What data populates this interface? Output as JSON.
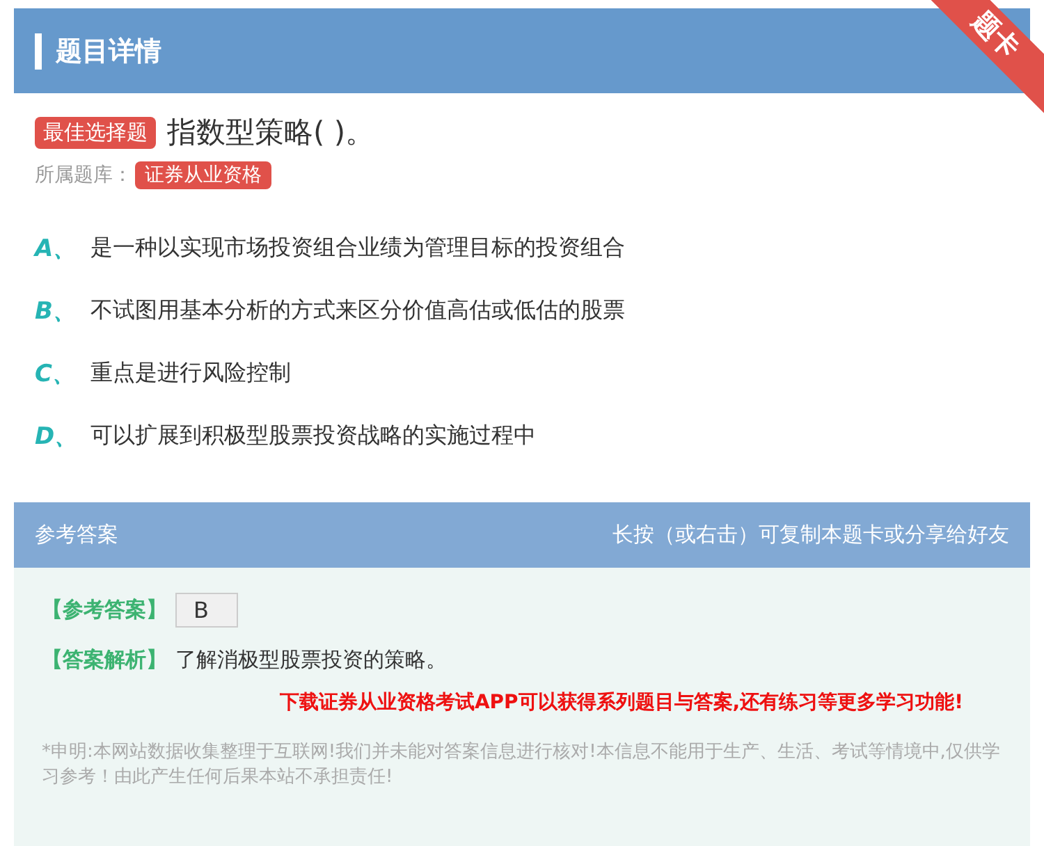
{
  "header": {
    "title": "题目详情",
    "ribbon": "题卡"
  },
  "question": {
    "type_tag": "最佳选择题",
    "text": "指数型策略( )。",
    "bank_label": "所属题库：",
    "bank_tag": "证券从业资格"
  },
  "options": [
    {
      "letter": "A、",
      "text": "是一种以实现市场投资组合业绩为管理目标的投资组合"
    },
    {
      "letter": "B、",
      "text": "不试图用基本分析的方式来区分价值高估或低估的股票"
    },
    {
      "letter": "C、",
      "text": "重点是进行风险控制"
    },
    {
      "letter": "D、",
      "text": "可以扩展到积极型股票投资战略的实施过程中"
    }
  ],
  "answer": {
    "title": "参考答案",
    "hint": "长按（或右击）可复制本题卡或分享给好友",
    "answer_label": "【参考答案】",
    "answer_value": "B",
    "analysis_label": "【答案解析】",
    "analysis_text": "了解消极型股票投资的策略。",
    "promo": "下载证券从业资格考试APP可以获得系列题目与答案,还有练习等更多学习功能!",
    "disclaimer": "*申明:本网站数据收集整理于互联网!我们并未能对答案信息进行核对!本信息不能用于生产、生活、考试等情境中,仅供学习参考！由此产生任何后果本站不承担责任!"
  }
}
